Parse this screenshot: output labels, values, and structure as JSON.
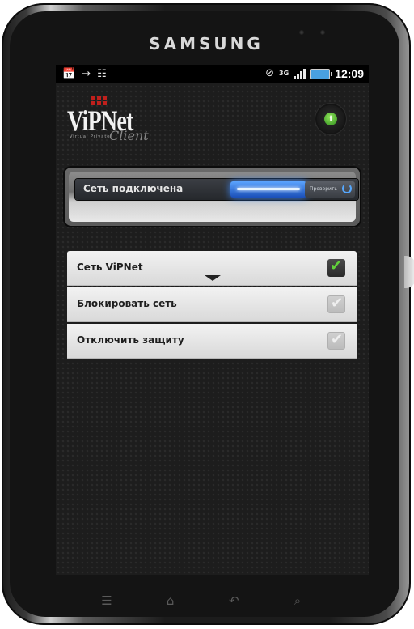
{
  "device": {
    "brand": "SAMSUNG"
  },
  "status_bar": {
    "time": "12:09",
    "network_type": "3G",
    "icons_left": [
      "calendar-icon",
      "usb-icon",
      "debug-icon"
    ],
    "icons_right": [
      "sync-icon",
      "network-3g-icon",
      "signal-icon",
      "battery-icon"
    ]
  },
  "app": {
    "logo_text": "ViPNet",
    "logo_subtext": "Virtual Private",
    "logo_client": "Client",
    "info_button_glyph": "i",
    "connection": {
      "status_label": "Сеть подключена",
      "check_label": "Проверить"
    },
    "settings": [
      {
        "label": "Сеть ViPNet",
        "checked": true
      },
      {
        "label": "Блокировать сеть",
        "checked": false
      },
      {
        "label": "Отключить защиту",
        "checked": false
      }
    ]
  },
  "nav": {
    "icons": [
      "menu-icon",
      "home-icon",
      "back-icon",
      "search-icon"
    ]
  },
  "colors": {
    "accent_green": "#61d03a",
    "glow_blue": "#3e8cff",
    "logo_red": "#c0201c"
  }
}
